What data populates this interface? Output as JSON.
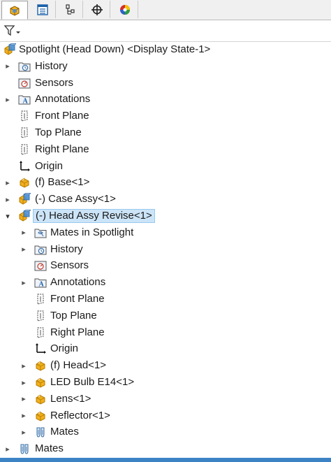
{
  "tabs": [
    {
      "name": "featuremanager",
      "icon": "assembly-cube-icon",
      "active": true
    },
    {
      "name": "propertymanager",
      "icon": "property-list-icon",
      "active": false
    },
    {
      "name": "configurationmanager",
      "icon": "configuration-tree-icon",
      "active": false
    },
    {
      "name": "dimxpertmanager",
      "icon": "crosshair-icon",
      "active": false
    },
    {
      "name": "displaymanager",
      "icon": "color-wheel-icon",
      "active": false
    }
  ],
  "filter": {
    "icon": "funnel-filter-icon"
  },
  "tree": [
    {
      "label": "Spotlight (Head Down) <Display State-1>",
      "icon": "assembly-icon",
      "level": 0,
      "arrow": "none"
    },
    {
      "label": "History",
      "icon": "history-folder-icon",
      "level": 1,
      "arrow": "collapsed"
    },
    {
      "label": "Sensors",
      "icon": "sensors-icon",
      "level": 1,
      "arrow": "none"
    },
    {
      "label": "Annotations",
      "icon": "annotations-folder-icon",
      "level": 1,
      "arrow": "collapsed"
    },
    {
      "label": "Front Plane",
      "icon": "plane-icon",
      "level": 1,
      "arrow": "none"
    },
    {
      "label": "Top Plane",
      "icon": "plane-icon",
      "level": 1,
      "arrow": "none"
    },
    {
      "label": "Right Plane",
      "icon": "plane-icon",
      "level": 1,
      "arrow": "none"
    },
    {
      "label": "Origin",
      "icon": "origin-icon",
      "level": 1,
      "arrow": "none"
    },
    {
      "label": "(f) Base<1>",
      "icon": "part-icon",
      "level": 1,
      "arrow": "collapsed"
    },
    {
      "label": "(-) Case Assy<1>",
      "icon": "assembly-icon",
      "level": 1,
      "arrow": "collapsed"
    },
    {
      "label": "(-) Head Assy Revise<1>",
      "icon": "assembly-icon",
      "level": 1,
      "arrow": "expanded",
      "selected": true
    },
    {
      "label": "Mates in Spotlight",
      "icon": "mates-folder-icon",
      "level": 2,
      "arrow": "collapsed"
    },
    {
      "label": "History",
      "icon": "history-folder-icon",
      "level": 2,
      "arrow": "collapsed"
    },
    {
      "label": "Sensors",
      "icon": "sensors-icon",
      "level": 2,
      "arrow": "none"
    },
    {
      "label": "Annotations",
      "icon": "annotations-folder-icon",
      "level": 2,
      "arrow": "collapsed"
    },
    {
      "label": "Front Plane",
      "icon": "plane-icon",
      "level": 2,
      "arrow": "none"
    },
    {
      "label": "Top Plane",
      "icon": "plane-icon",
      "level": 2,
      "arrow": "none"
    },
    {
      "label": "Right Plane",
      "icon": "plane-icon",
      "level": 2,
      "arrow": "none"
    },
    {
      "label": "Origin",
      "icon": "origin-icon",
      "level": 2,
      "arrow": "none"
    },
    {
      "label": "(f) Head<1>",
      "icon": "part-icon",
      "level": 2,
      "arrow": "collapsed"
    },
    {
      "label": "LED Bulb E14<1>",
      "icon": "part-icon",
      "level": 2,
      "arrow": "collapsed"
    },
    {
      "label": "Lens<1>",
      "icon": "part-icon",
      "level": 2,
      "arrow": "collapsed"
    },
    {
      "label": "Reflector<1>",
      "icon": "part-icon",
      "level": 2,
      "arrow": "collapsed"
    },
    {
      "label": "Mates",
      "icon": "mates-icon",
      "level": 2,
      "arrow": "collapsed"
    },
    {
      "label": "Mates",
      "icon": "mates-icon",
      "level": 1,
      "arrow": "collapsed"
    }
  ],
  "colors": {
    "part_yellow": "#f2b01e",
    "part_dark": "#b57b00",
    "folder_blue": "#3a6ea5",
    "selection": "#cce4f7",
    "accent": "#3b83c4"
  }
}
